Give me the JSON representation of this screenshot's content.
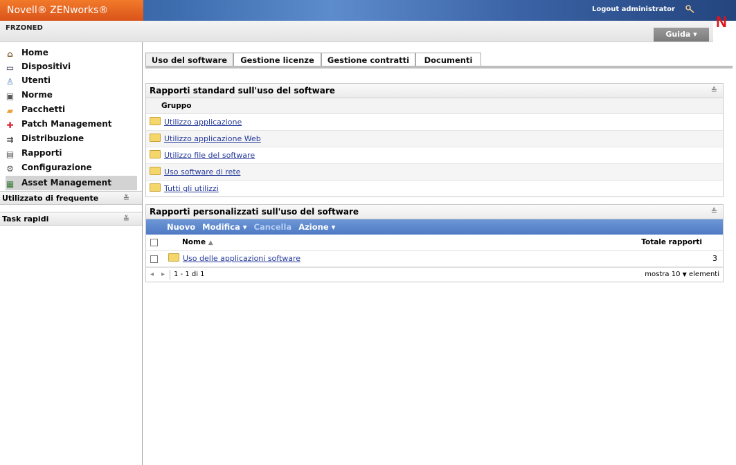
{
  "header": {
    "brand": "Novell® ZENworks®",
    "logout": "Logout administrator",
    "zone": "FRZONED",
    "help": "Guida ▾",
    "logo_letter": "N"
  },
  "sidebar": {
    "items": [
      {
        "label": "Home",
        "icon": "home-icon",
        "glyph": "⌂"
      },
      {
        "label": "Dispositivi",
        "icon": "monitor-icon",
        "glyph": "▭"
      },
      {
        "label": "Utenti",
        "icon": "user-icon",
        "glyph": "♙"
      },
      {
        "label": "Norme",
        "icon": "policy-icon",
        "glyph": "▣"
      },
      {
        "label": "Pacchetti",
        "icon": "bundle-icon",
        "glyph": "▰"
      },
      {
        "label": "Patch Management",
        "icon": "patch-icon",
        "glyph": "✚"
      },
      {
        "label": "Distribuzione",
        "icon": "deployment-icon",
        "glyph": "⇉"
      },
      {
        "label": "Rapporti",
        "icon": "report-icon",
        "glyph": "▤"
      },
      {
        "label": "Configurazione",
        "icon": "configuration-icon",
        "glyph": "⚙"
      },
      {
        "label": "Asset Management",
        "icon": "asset-icon",
        "glyph": "▦"
      }
    ],
    "panels": [
      "Utilizzato di frequente",
      "Task rapidi"
    ]
  },
  "tabs": [
    "Uso del software",
    "Gestione licenze",
    "Gestione contratti",
    "Documenti"
  ],
  "standard": {
    "title": "Rapporti standard sull'uso del software",
    "column": "Gruppo",
    "rows": [
      "Utilizzo applicazione",
      "Utilizzo applicazione Web",
      "Utilizzo file del software",
      "Uso software di rete",
      "Tutti gli utilizzi"
    ]
  },
  "custom": {
    "title": "Rapporti personalizzati sull'uso del software",
    "toolbar": {
      "new": "Nuovo",
      "edit": "Modifica ▾",
      "delete": "Cancella",
      "action": "Azione ▾"
    },
    "col_name": "Nome",
    "col_total": "Totale rapporti",
    "rows": [
      {
        "name": "Uso delle applicazioni software",
        "total": "3"
      }
    ],
    "pager": "1 - 1 di 1",
    "show": "mostra",
    "page_size": "10",
    "items_label": "elementi"
  },
  "colors": {
    "accent_orange": "#e0641f",
    "header_blue": "#3b63a6",
    "toolbar_blue": "#5d87cf",
    "link": "#23389a"
  }
}
